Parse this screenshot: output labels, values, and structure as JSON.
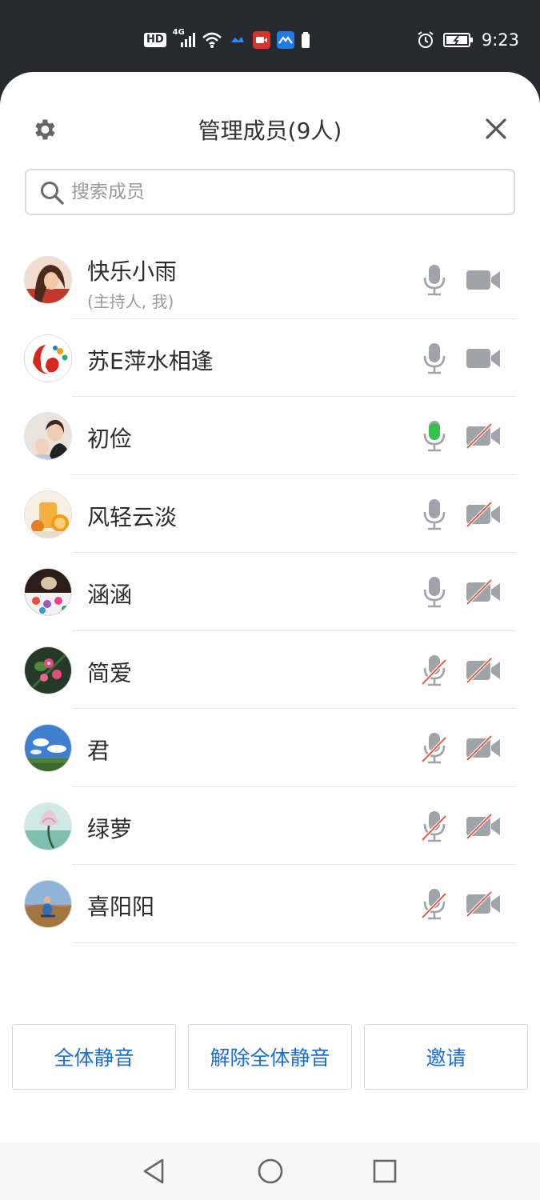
{
  "status_bar": {
    "hd": "HD",
    "network": "4G",
    "time": "9:23"
  },
  "header": {
    "title": "管理成员(9人)"
  },
  "search": {
    "placeholder": "搜索成员"
  },
  "members": [
    {
      "name": "快乐小雨",
      "role": "(主持人, 我)",
      "mic": "idle",
      "camera": "on"
    },
    {
      "name": "苏E萍水相逢",
      "mic": "idle",
      "camera": "on"
    },
    {
      "name": "初俭",
      "mic": "speaking",
      "camera": "off"
    },
    {
      "name": "风轻云淡",
      "mic": "idle",
      "camera": "off"
    },
    {
      "name": "涵涵",
      "mic": "idle",
      "camera": "off"
    },
    {
      "name": "简爱",
      "mic": "muted",
      "camera": "off"
    },
    {
      "name": "君",
      "mic": "muted",
      "camera": "off"
    },
    {
      "name": "绿萝",
      "mic": "muted",
      "camera": "off"
    },
    {
      "name": "喜阳阳",
      "mic": "muted",
      "camera": "off"
    }
  ],
  "actions": {
    "mute_all": "全体静音",
    "unmute_all": "解除全体静音",
    "invite": "邀请"
  },
  "colors": {
    "accent": "#1a6fd1",
    "speaking": "#35c14a",
    "muted_slash": "#e0503c",
    "icon_gray": "#a0a3a8"
  }
}
